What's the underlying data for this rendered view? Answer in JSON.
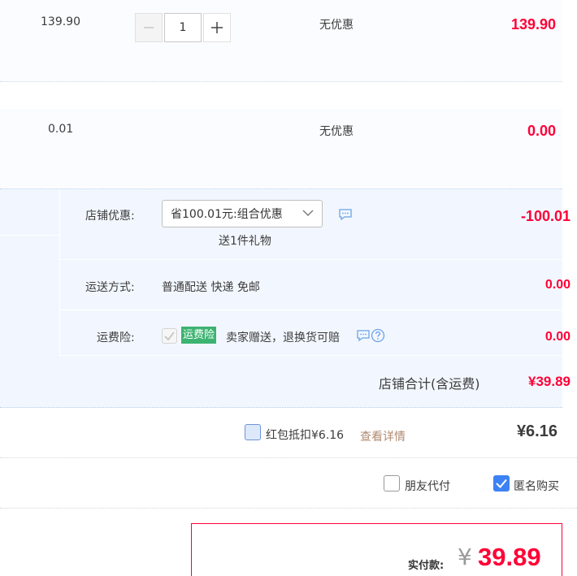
{
  "items": [
    {
      "price": "139.90",
      "quantity": "1",
      "promotion": "无优惠",
      "subtotal": "139.90"
    },
    {
      "price": "0.01",
      "promotion": "无优惠",
      "subtotal": "0.00"
    }
  ],
  "shop": {
    "discount": {
      "label": "店铺优惠:",
      "selected": "省100.01元:组合优惠",
      "gift": "送1件礼物",
      "amount": "-100.01"
    },
    "shipping": {
      "label": "运送方式:",
      "value": "普通配送 快递 免邮",
      "amount": "0.00"
    },
    "insurance": {
      "label": "运费险:",
      "badge": "运费险",
      "text": "卖家赠送，退换货可赔",
      "amount": "0.00"
    },
    "total": {
      "label": "店铺合计(含运费)",
      "amount": "¥39.89"
    }
  },
  "redpacket": {
    "label": "红包抵扣¥6.16",
    "link": "查看详情",
    "amount": "¥6.16"
  },
  "options": {
    "friend_pay": "朋友代付",
    "anonymous": "匿名购买"
  },
  "payment": {
    "label": "实付款:",
    "currency": "¥",
    "amount": "39.89"
  },
  "colors": {
    "accent_red": "#ff0036",
    "badge_green": "#3cb371",
    "checkbox_blue": "#3d82f5"
  }
}
